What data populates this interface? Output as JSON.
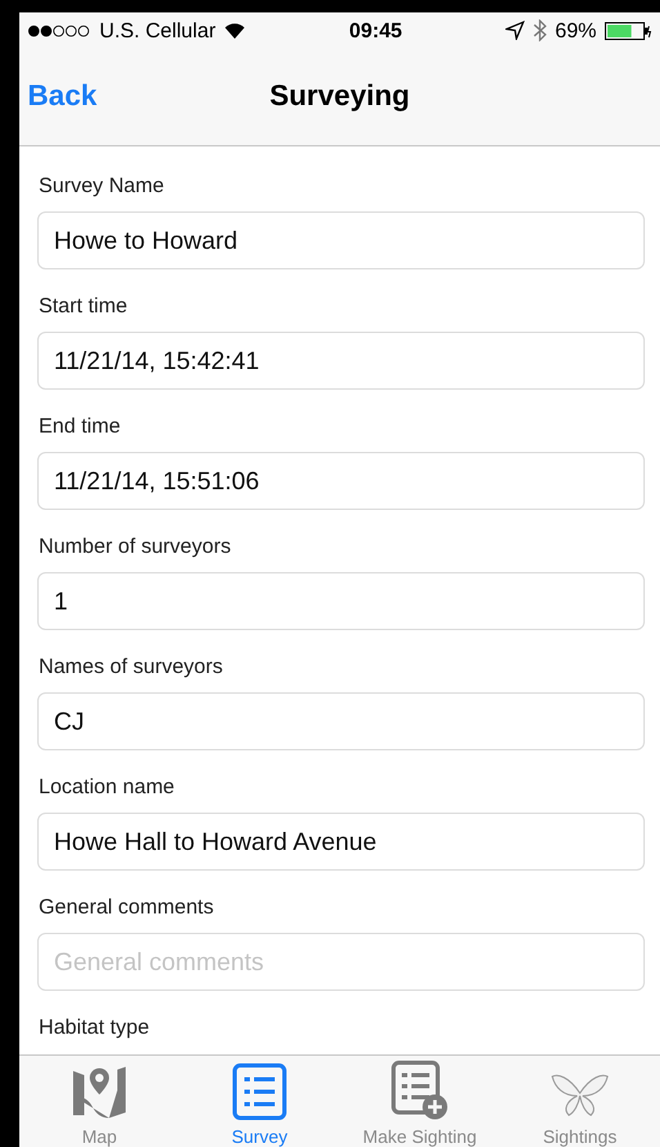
{
  "status_bar": {
    "carrier": "U.S. Cellular",
    "time": "09:45",
    "battery_text": "69%",
    "battery": {
      "level": 0.69
    }
  },
  "nav_bar": {
    "back": "Back",
    "title": "Surveying"
  },
  "form": [
    {
      "label": "Survey Name",
      "value": "Howe to Howard"
    },
    {
      "label": "Start time",
      "value": "11/21/14, 15:42:41"
    },
    {
      "label": "End time",
      "value": "11/21/14, 15:51:06"
    },
    {
      "label": "Number of surveyors",
      "value": "1"
    },
    {
      "label": "Names of surveyors",
      "value": "CJ"
    },
    {
      "label": "Location name",
      "value": "Howe Hall to Howard Avenue"
    },
    {
      "label": "General comments",
      "placeholder": "General comments"
    },
    {
      "label": "Habitat type"
    }
  ],
  "tabs": [
    {
      "kind": "map",
      "label": "Map",
      "selected": false
    },
    {
      "kind": "list",
      "label": "Survey",
      "selected": true
    },
    {
      "kind": "add",
      "label": "Make Sighting",
      "selected": false
    },
    {
      "kind": "butterfly",
      "label": "Sightings",
      "selected": false
    }
  ]
}
